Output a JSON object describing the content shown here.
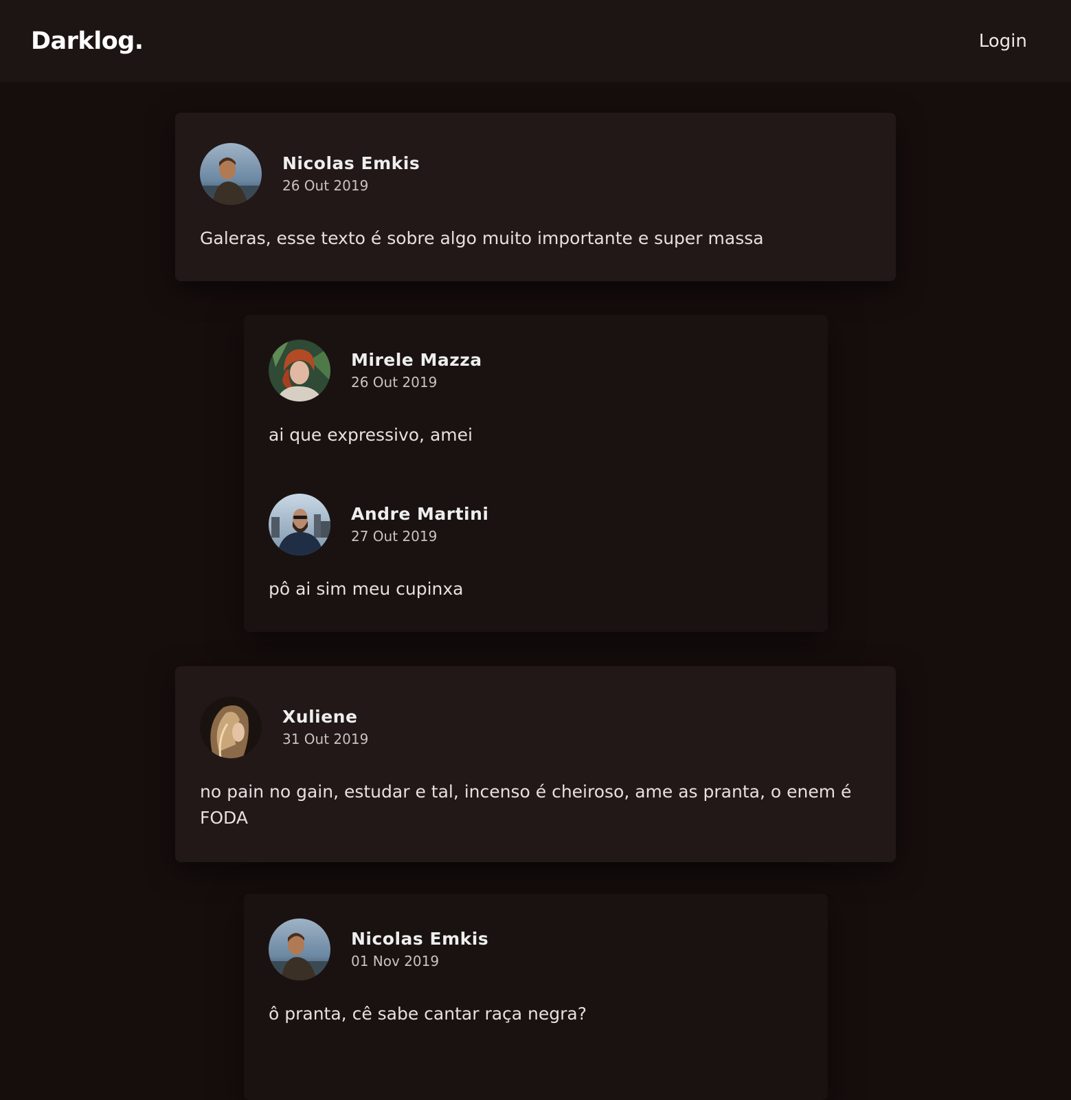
{
  "header": {
    "brand": "Darklog.",
    "login_label": "Login"
  },
  "posts": [
    {
      "author": "Nicolas Emkis",
      "date": "26 Out 2019",
      "text": "Galeras, esse texto é sobre algo muito importante e super massa",
      "replies": [
        {
          "author": "Mirele Mazza",
          "date": "26 Out 2019",
          "text": "ai que expressivo, amei"
        },
        {
          "author": "Andre Martini",
          "date": "27 Out 2019",
          "text": "pô ai sim meu cupinxa"
        }
      ]
    },
    {
      "author": "Xuliene",
      "date": "31 Out 2019",
      "text": "no pain no gain, estudar e tal, incenso é cheiroso, ame as pranta, o enem é FODA",
      "replies": [
        {
          "author": "Nicolas Emkis",
          "date": "01 Nov 2019",
          "text": "ô pranta, cê sabe cantar raça negra?"
        }
      ]
    }
  ],
  "colors": {
    "background": "#160e0d",
    "header": "#1d1514",
    "post_card": "#221818",
    "reply_card": "#1a1211"
  }
}
